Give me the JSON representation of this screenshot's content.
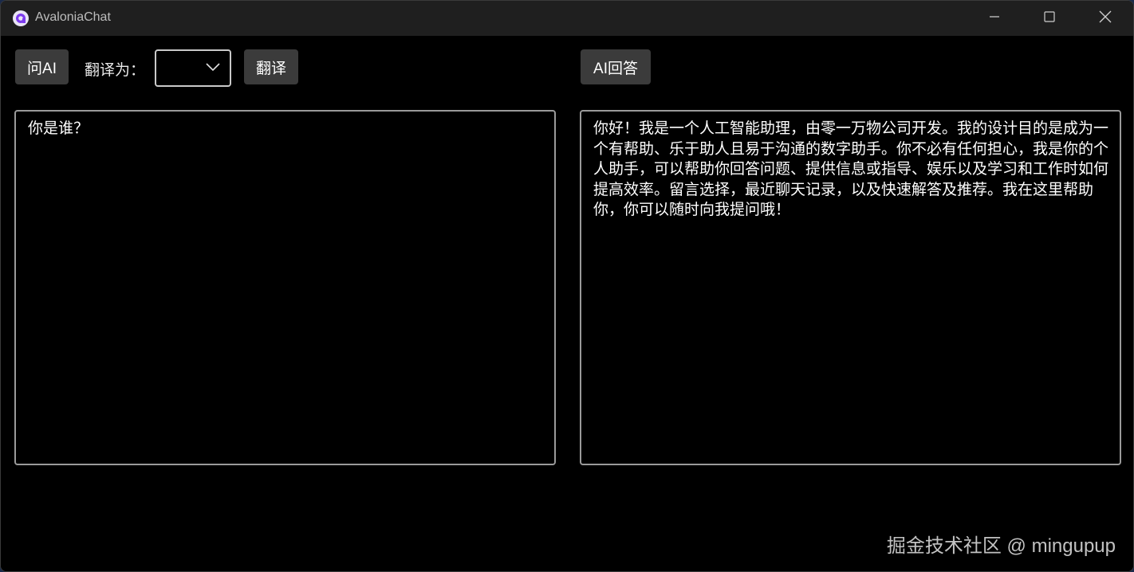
{
  "window": {
    "title": "AvaloniaChat"
  },
  "toolbar": {
    "ask_ai_label": "问AI",
    "translate_to_label": "翻译为：",
    "language_select_value": "",
    "translate_label": "翻译",
    "ai_answer_label": "AI回答"
  },
  "input": {
    "text": "你是谁？"
  },
  "output": {
    "text": "你好！我是一个人工智能助理，由零一万物公司开发。我的设计目的是成为一个有帮助、乐于助人且易于沟通的数字助手。你不必有任何担心，我是你的个人助手，可以帮助你回答问题、提供信息或指导、娱乐以及学习和工作时如何提高效率。留言选择，最近聊天记录，以及快速解答及推荐。我在这里帮助你，你可以随时向我提问哦！"
  },
  "watermark": {
    "text": "掘金技术社区 @ mingupup"
  },
  "icons": {
    "app": "avalonia-logo-icon",
    "minimize": "minimize-icon",
    "maximize": "maximize-icon",
    "close": "close-icon",
    "dropdown": "chevron-down-icon"
  },
  "colors": {
    "background": "#000000",
    "titlebar": "#1f1f1f",
    "button": "#3b3b3b",
    "border": "#9a9a9a",
    "logo": "#8b5cf6"
  }
}
